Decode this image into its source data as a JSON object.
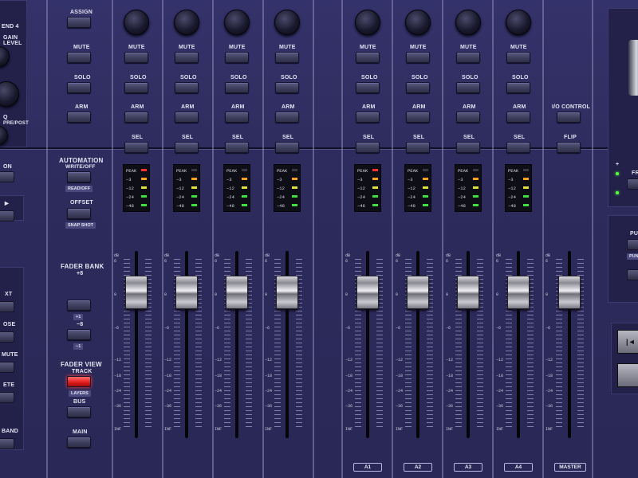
{
  "left_edge": {
    "labels": [
      "END 4",
      "GAIN",
      "LEVEL",
      "Q",
      "PRE/POST",
      "ON",
      "XT",
      "OSE",
      "MUTE",
      "ETE",
      "BAND"
    ],
    "arrow": "►"
  },
  "center_controls": {
    "assign": "ASSIGN",
    "automation": {
      "title": "AUTOMATION",
      "subtitle": "WRITE/OFF",
      "read": "READ/OFF",
      "offset": "OFFSET",
      "snapshot": "SNAP SHOT"
    },
    "fader_bank": {
      "title": "FADER BANK",
      "plus8": "+8",
      "plus1": "+1",
      "minus8": "−8",
      "minus1": "−1"
    },
    "fader_view": {
      "title": "FADER VIEW",
      "track": "TRACK",
      "layers": "LAYERS",
      "bus": "BUS",
      "main": "MAIN"
    }
  },
  "strip_labels": {
    "mute": "MUTE",
    "solo": "SOLO",
    "arm": "ARM",
    "sel": "SEL"
  },
  "meter_scale": [
    "PEAK",
    "−3",
    "−12",
    "−24",
    "−48"
  ],
  "fader_scale": [
    "dB",
    "6",
    "0",
    "−6",
    "−12",
    "−18",
    "−24",
    "−36",
    "INF"
  ],
  "channels": [
    {
      "name": "",
      "peak": true
    },
    {
      "name": "",
      "peak": false
    },
    {
      "name": "",
      "peak": false
    },
    {
      "name": "",
      "peak": false
    },
    {
      "name": "A1",
      "peak": true
    },
    {
      "name": "A2",
      "peak": false
    },
    {
      "name": "A3",
      "peak": false
    },
    {
      "name": "A4",
      "peak": false
    }
  ],
  "master": {
    "io_control": "I/O CONTROL",
    "flip": "FLIP",
    "name": "MASTER"
  },
  "right_edge": {
    "labels": [
      "+",
      "FR",
      "PU",
      "PUNC"
    ],
    "transport": "|◄"
  }
}
